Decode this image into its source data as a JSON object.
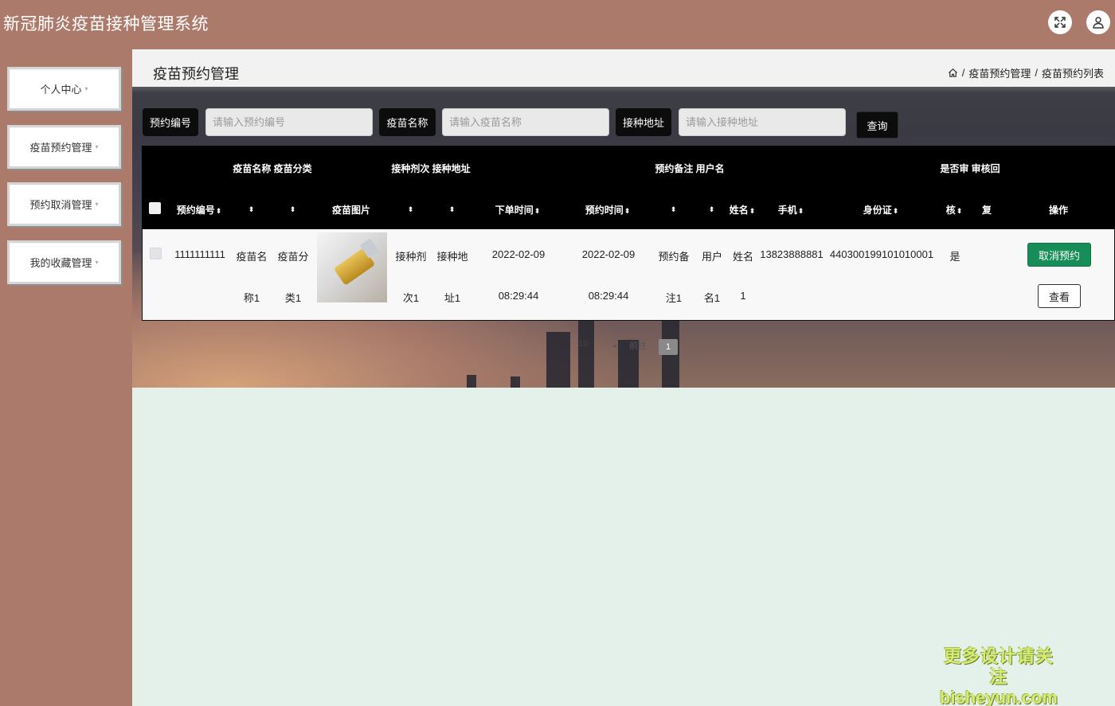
{
  "header": {
    "title": "新冠肺炎疫苗接种管理系统",
    "fullscreen_icon": "fullscreen-icon",
    "user_icon": "user-icon"
  },
  "sidebar": {
    "items": [
      {
        "label": "个人中心"
      },
      {
        "label": "疫苗预约管理"
      },
      {
        "label": "预约取消管理"
      },
      {
        "label": "我的收藏管理"
      }
    ],
    "caret": "▾"
  },
  "page": {
    "title": "疫苗预约管理",
    "breadcrumb": {
      "home_icon": "home-icon",
      "sep": "/",
      "level1": "疫苗预约管理",
      "level2": "疫苗预约列表"
    }
  },
  "search": {
    "label1": "预约编号",
    "placeholder1": "请输入预约编号",
    "label2": "疫苗名称",
    "placeholder2": "请输入疫苗名称",
    "label3": "接种地址",
    "placeholder3": "请输入接种地址",
    "button": "查询"
  },
  "table": {
    "headers_top": {
      "g1": "疫苗名称 疫苗分类",
      "g2": "接种剂次 接种地址",
      "g3": "预约备注 用户名",
      "g4": "是否审 审核回"
    },
    "headers": {
      "order_no": "预约编号",
      "image": "疫苗图片",
      "order_time": "下单时间",
      "appoint_time": "预约时间",
      "name": "姓名",
      "phone": "手机",
      "id_card": "身份证",
      "audit": "核",
      "reply": "复",
      "actions": "操作"
    },
    "sort_glyph": "⬍",
    "row": {
      "order_no": "1111111111",
      "vaccine_name_a": "疫苗名",
      "vaccine_name_b": "称1",
      "vaccine_type_a": "疫苗分",
      "vaccine_type_b": "类1",
      "dose_a": "接种剂",
      "dose_b": "次1",
      "address_a": "接种地",
      "address_b": "址1",
      "order_date": "2022-02-09",
      "order_clock": "08:29:44",
      "appoint_date": "2022-02-09",
      "appoint_clock": "08:29:44",
      "note_a": "预约备",
      "note_b": "注1",
      "user_a": "用户",
      "user_b": "名1",
      "name_a": "姓名",
      "name_b": "1",
      "phone": "13823888881",
      "id_card": "440300199101010001",
      "audit": "是",
      "cancel_btn": "取消预约",
      "view_btn": "查看"
    }
  },
  "pagination": {
    "page_size": "10",
    "goto": "前往",
    "current_page": "1"
  },
  "watermark": {
    "line1": "更多设计请关注",
    "line2": "bisheyun.com"
  },
  "colors": {
    "header_bg": "#ac7a6b",
    "main_bg": "#e4f1ea",
    "cancel_btn": "#178d59",
    "table_head": "#000000"
  }
}
